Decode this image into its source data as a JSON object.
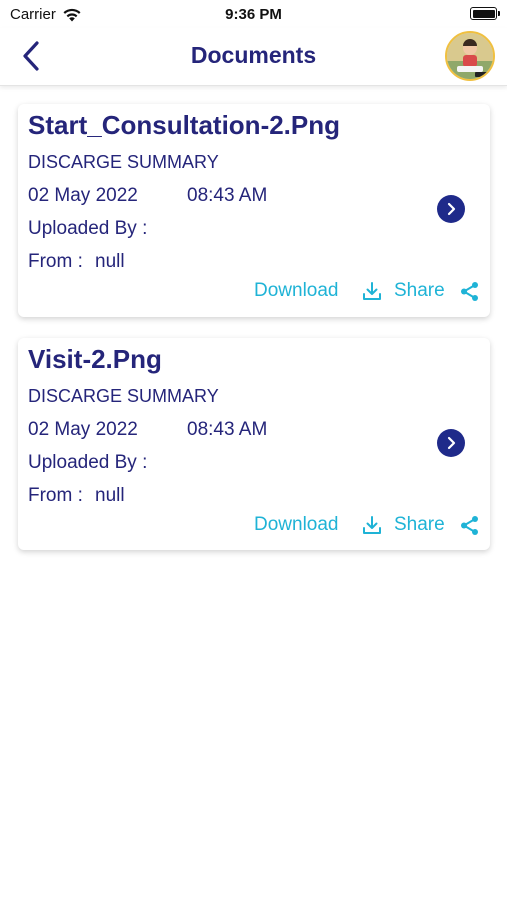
{
  "status_bar": {
    "carrier": "Carrier",
    "time": "9:36 PM",
    "wifi_icon": "wifi-icon",
    "battery_icon": "battery-icon"
  },
  "nav": {
    "title": "Documents",
    "back_icon": "chevron-left-icon",
    "avatar": "user-avatar"
  },
  "colors": {
    "primary": "#25257a",
    "accent": "#1fb3d6",
    "detail_button": "#1f2a8a"
  },
  "documents": [
    {
      "name": "Start_Consultation-2.Png",
      "type": "DISCARGE SUMMARY",
      "date": "02 May 2022",
      "time": "08:43 AM",
      "uploaded_by_label": "Uploaded By :",
      "from_label": "From :",
      "from_value": "null",
      "download_label": "Download",
      "share_label": "Share"
    },
    {
      "name": "Visit-2.Png",
      "type": "DISCARGE SUMMARY",
      "date": "02 May 2022",
      "time": "08:43 AM",
      "uploaded_by_label": "Uploaded By :",
      "from_label": "From :",
      "from_value": "null",
      "download_label": "Download",
      "share_label": "Share"
    }
  ]
}
